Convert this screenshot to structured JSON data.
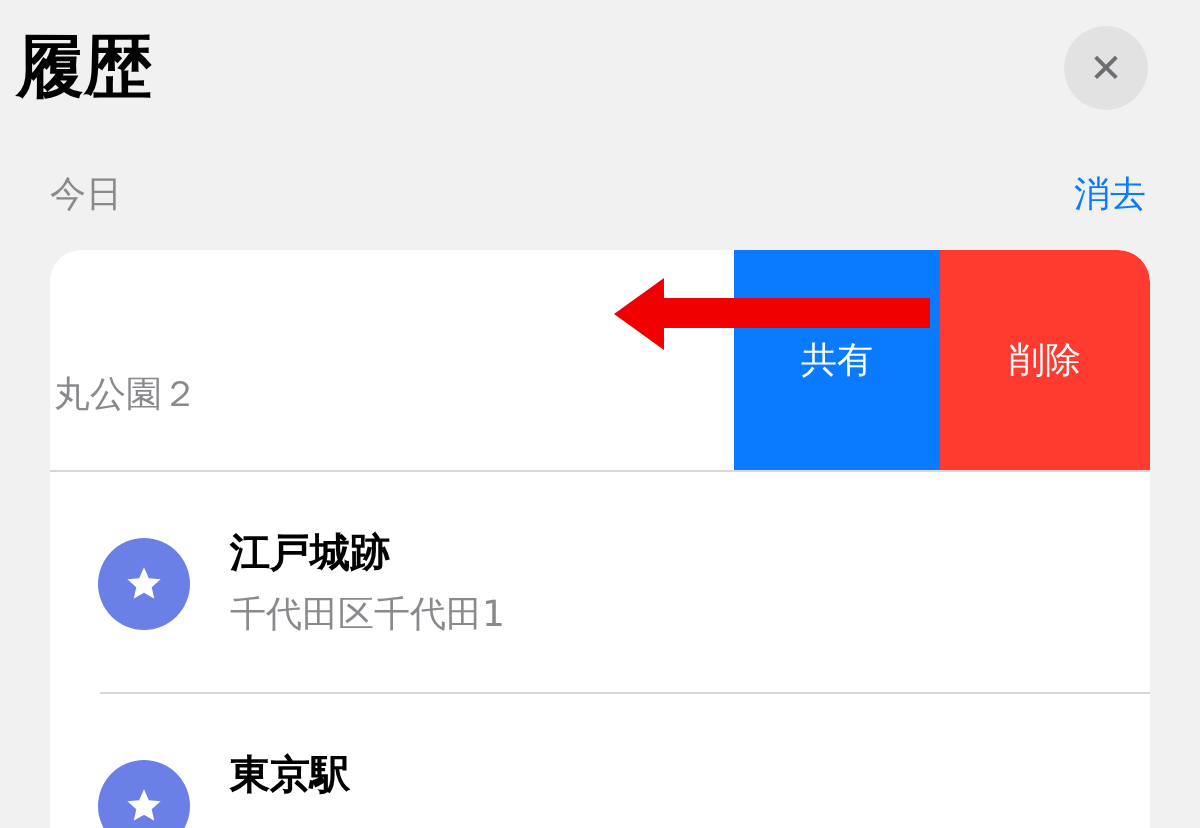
{
  "header": {
    "title": "履歴",
    "close_label": "✕"
  },
  "section": {
    "title": "今日",
    "action": "消去"
  },
  "rows": [
    {
      "kind": "swiped",
      "subtitle": "丸公園２",
      "actions": [
        {
          "label": "共有",
          "kind": "share"
        },
        {
          "label": "削除",
          "kind": "delete"
        }
      ]
    },
    {
      "kind": "place",
      "title": "江戸城跡",
      "subtitle": "千代田区千代田1"
    },
    {
      "kind": "place",
      "title": "東京駅"
    }
  ]
}
